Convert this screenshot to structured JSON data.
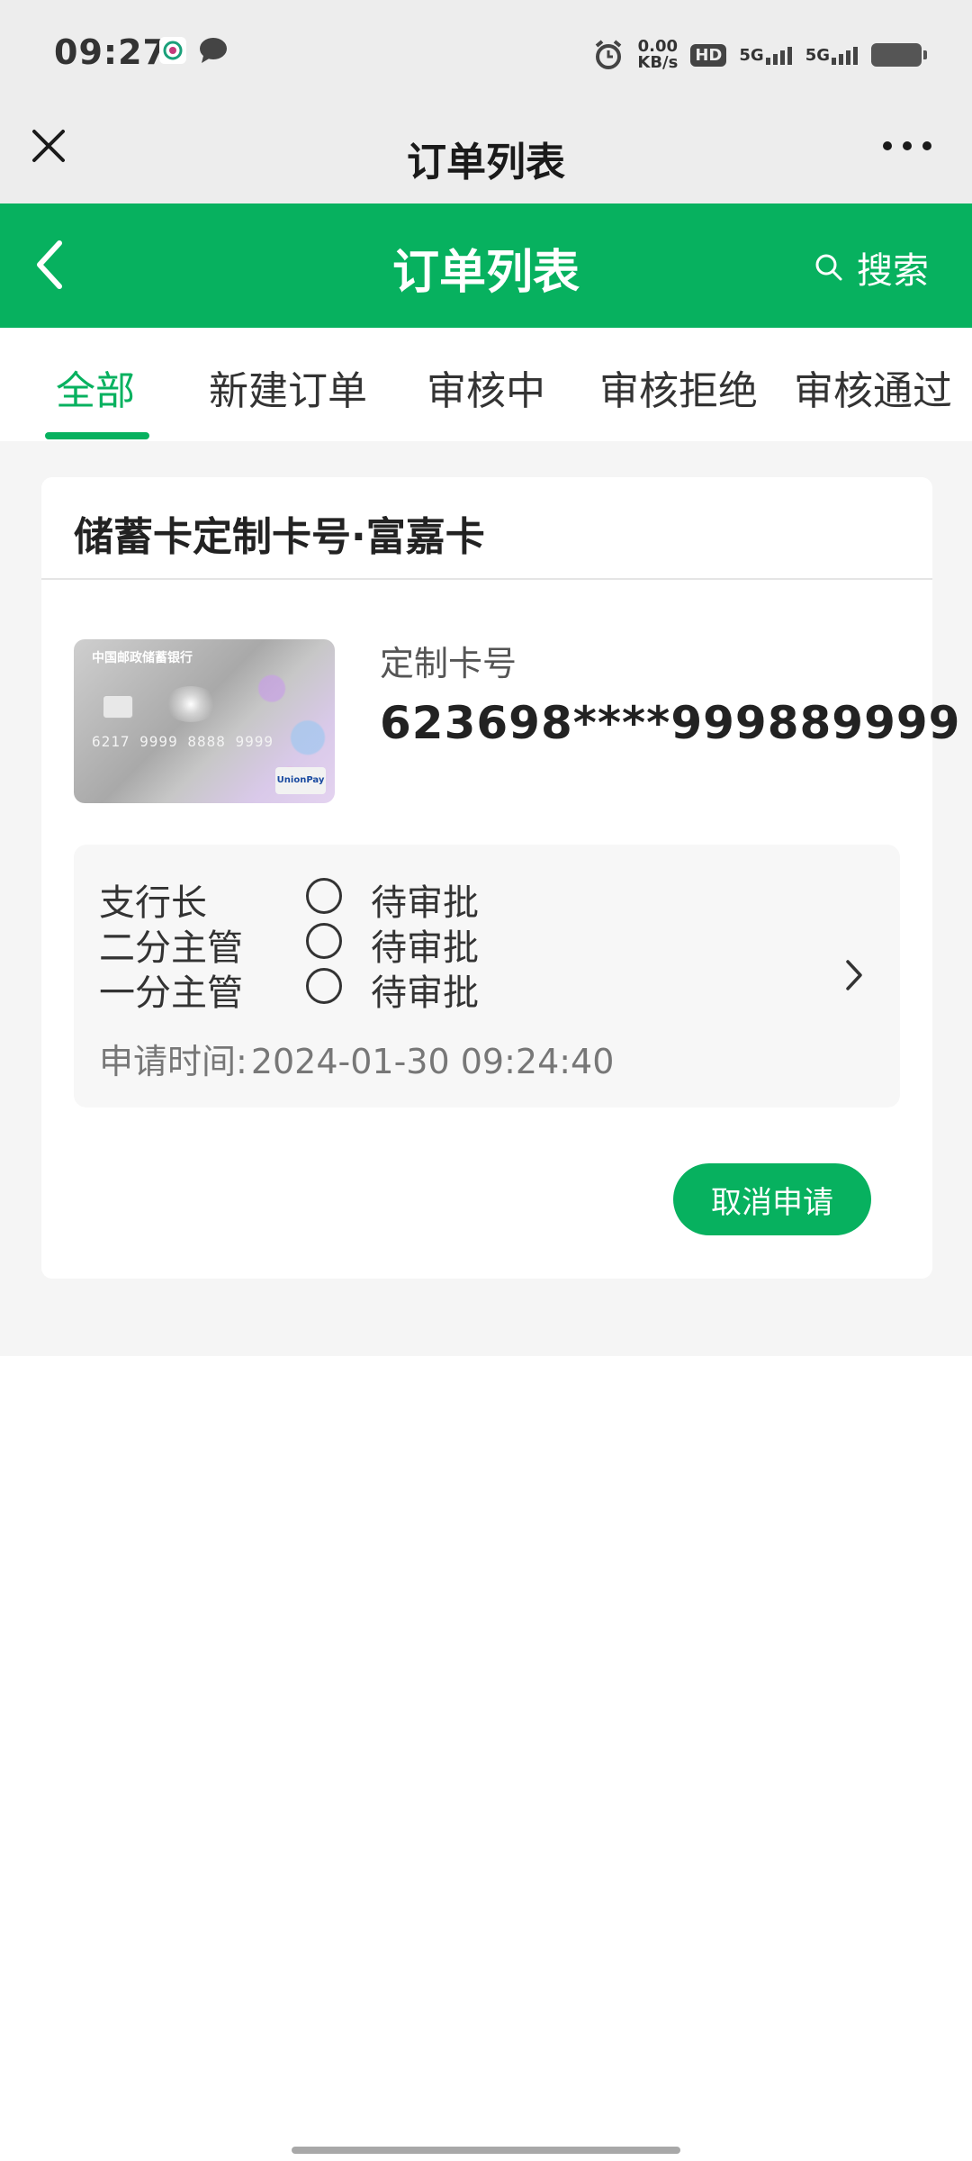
{
  "status_bar": {
    "time": "09:27",
    "net_speed_value": "0.00",
    "net_speed_unit": "KB/s",
    "hd_label": "HD",
    "sim1_label": "5G",
    "sim2_label": "5G"
  },
  "window": {
    "title": "订单列表"
  },
  "header": {
    "title": "订单列表",
    "search_label": "搜索",
    "accent_color": "#07b15f"
  },
  "tabs": [
    {
      "label": "全部",
      "active": true
    },
    {
      "label": "新建订单",
      "active": false
    },
    {
      "label": "审核中",
      "active": false
    },
    {
      "label": "审核拒绝",
      "active": false
    },
    {
      "label": "审核通过",
      "active": false
    }
  ],
  "order": {
    "title": "储蓄卡定制卡号·富嘉卡",
    "card_image_alt": {
      "bank_name": "中国邮政储蓄银行",
      "card_number_preview": "6217 9999 8888 9999",
      "network": "UnionPay"
    },
    "custom_number_label": "定制卡号",
    "custom_number_value": "623698****999889999",
    "approvals": [
      {
        "role": "支行长",
        "status": "待审批"
      },
      {
        "role": "二分主管",
        "status": "待审批"
      },
      {
        "role": "一分主管",
        "status": "待审批"
      }
    ],
    "apply_time_label": "申请时间:",
    "apply_time_value": "2024-01-30 09:24:40",
    "cancel_button_label": "取消申请"
  }
}
